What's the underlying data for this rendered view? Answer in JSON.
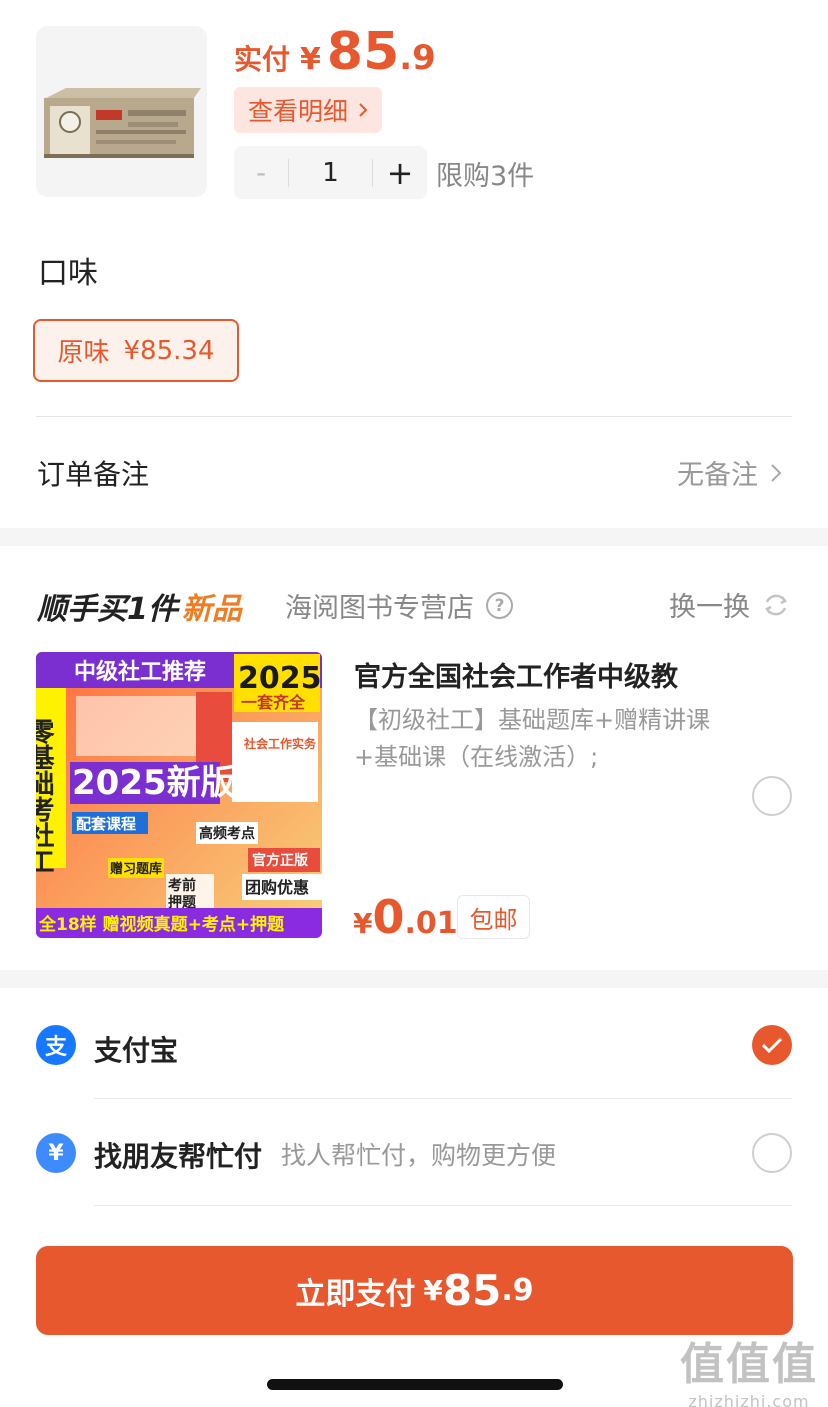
{
  "product": {
    "image_icon": "instant-noodle-box-thumbnail",
    "price_label": "实付",
    "currency": "¥",
    "price_int": "85",
    "price_dec": ".9",
    "detail_label": "查看明细",
    "quantity_minus": "-",
    "quantity": "1",
    "quantity_plus": "+",
    "limit_text": "限购3件"
  },
  "flavor": {
    "title": "口味",
    "option_name": "原味",
    "option_price": "¥85.34"
  },
  "remark": {
    "label": "订单备注",
    "value": "无备注"
  },
  "addon": {
    "title_main": "顺手买1件",
    "title_tag": "新品",
    "shop_name": "海阅图书专营店",
    "swap_label": "换一换",
    "book": {
      "image_icon": "book-cover-image",
      "cover_banner": "中级社工推荐",
      "cover_year": "2025",
      "cover_sub": "一套齐全",
      "cover_side": "零基础考社工",
      "cover_big": "2025新版",
      "cover_tag1": "配套课程",
      "cover_tag2": "高频考点",
      "cover_tag3": "赠习题库",
      "cover_tag4": "考前押题",
      "cover_official": "官方正版",
      "cover_group": "团购优惠",
      "cover_bottom": "全18样 赠视频真题+考点+押题",
      "title": "官方全国社会工作者中级教",
      "desc": "【初级社工】基础题库+赠精讲课+基础课（在线激活）;",
      "price_sym": "¥",
      "price_int": "0",
      "price_dec": ".01",
      "shipping": "包邮"
    }
  },
  "payment": {
    "alipay_label": "支付宝",
    "alipay_icon_text": "支",
    "friend_label": "找朋友帮忙付",
    "friend_icon_text": "¥",
    "friend_sub": "找人帮忙付，购物更方便"
  },
  "pay_button": {
    "label": "立即支付",
    "currency": "¥",
    "amount_int": "85",
    "amount_dec": ".9"
  },
  "watermark": {
    "big": "值值值",
    "small": "zhizhizhi.com"
  },
  "colors": {
    "accent": "#e8582e",
    "alipay_blue": "#1677ff",
    "tag_bg": "#fde6df",
    "new_tag": "#ee7d25"
  }
}
